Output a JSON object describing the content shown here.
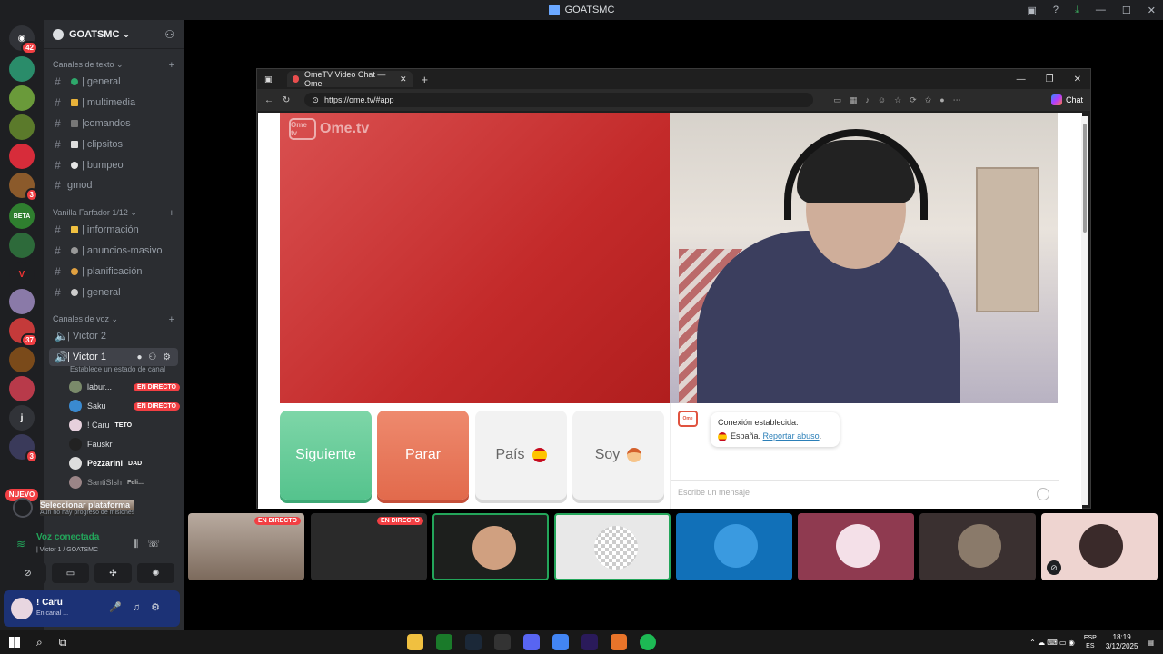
{
  "titlebar": {
    "title": "GOATSMC"
  },
  "rail": {
    "badges": {
      "dm": "42",
      "s5": "3",
      "s10": "37",
      "s14": "3"
    },
    "letter_server": "j",
    "nuevo": "NUEVO"
  },
  "server": {
    "name": "GOATSMC"
  },
  "categories": {
    "text": "Canales de texto",
    "vanilla": "Vanilla Farfador 1/12",
    "voice": "Canales de voz"
  },
  "text_channels": [
    {
      "label": "| general"
    },
    {
      "label": "| multimedia"
    },
    {
      "label": "|comandos"
    },
    {
      "label": "| clipsitos"
    },
    {
      "label": "| bumpeo"
    },
    {
      "label": "gmod"
    }
  ],
  "vanilla_channels": [
    {
      "label": "| información"
    },
    {
      "label": "| anuncios-masivo"
    },
    {
      "label": "| planificación"
    },
    {
      "label": "| general"
    }
  ],
  "voice_channels": [
    {
      "label": "| Victor 2"
    },
    {
      "label": "| Victor 1"
    }
  ],
  "channel_status": "Establece un estado de canal",
  "voice_users": [
    {
      "name": "labur...",
      "badge": "EN DIRECTO"
    },
    {
      "name": "Saku",
      "badge": "EN DIRECTO"
    },
    {
      "name": "! Caru",
      "badge": "TETO"
    },
    {
      "name": "Fauskr",
      "badge": ""
    },
    {
      "name": "Pezzarini",
      "badge": "DAD"
    },
    {
      "name": "SantiSlsh",
      "badge": "Feli..."
    }
  ],
  "platform": {
    "title": "Seleccionar plataforma",
    "subtitle": "Aún no hay progreso de misiones"
  },
  "voice": {
    "status": "Voz conectada",
    "channel": "| Victor 1 / GOATSMC"
  },
  "user": {
    "name": "! Caru",
    "status": "En canal ..."
  },
  "browser": {
    "tab_title": "OmeTV Video Chat — Ome",
    "url": "https://ome.tv/#app",
    "copilot": "Chat"
  },
  "ome": {
    "logo_text": "Ome.tv",
    "logo_box": "Ome tv",
    "next": "Siguiente",
    "stop": "Parar",
    "country": "País",
    "iam": "Soy",
    "connected": "Conexión establecida.",
    "country_name": "España.",
    "report": "Reportar abuso",
    "input_placeholder": "Escribe un mensaje"
  },
  "tiles": {
    "live1": "EN DIRECTO",
    "live2": "EN DIRECTO"
  },
  "taskbar": {
    "time": "18:19",
    "date": "3/12/2025",
    "lang1": "ESP",
    "lang2": "ES"
  },
  "colors": {
    "discord_green": "#23a55a",
    "live_red": "#f23f43",
    "ome_red": "#c32a2a",
    "next_green": "#55c38d"
  }
}
